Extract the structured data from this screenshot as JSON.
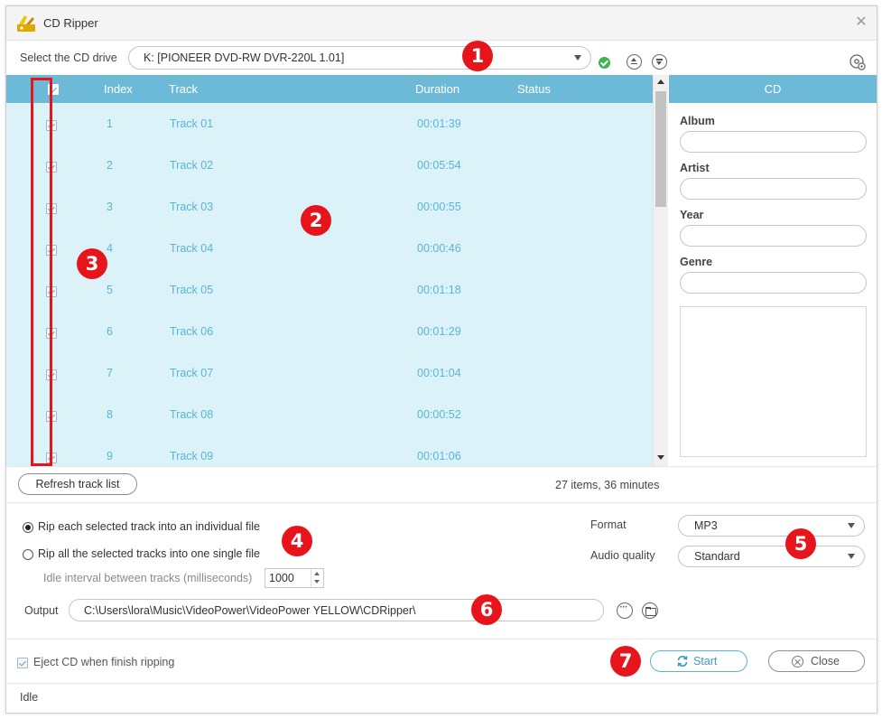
{
  "window": {
    "title": "CD Ripper"
  },
  "drive": {
    "label": "Select the CD drive",
    "selected": "K: [PIONEER DVD-RW  DVR-220L 1.01]",
    "status_color": "#3cb54a"
  },
  "table": {
    "columns": {
      "index": "Index",
      "track": "Track",
      "duration": "Duration",
      "status": "Status"
    },
    "rows": [
      {
        "index": "1",
        "track": "Track 01",
        "duration": "00:01:39",
        "status": ""
      },
      {
        "index": "2",
        "track": "Track 02",
        "duration": "00:05:54",
        "status": ""
      },
      {
        "index": "3",
        "track": "Track 03",
        "duration": "00:00:55",
        "status": ""
      },
      {
        "index": "4",
        "track": "Track 04",
        "duration": "00:00:46",
        "status": ""
      },
      {
        "index": "5",
        "track": "Track 05",
        "duration": "00:01:18",
        "status": ""
      },
      {
        "index": "6",
        "track": "Track 06",
        "duration": "00:01:29",
        "status": ""
      },
      {
        "index": "7",
        "track": "Track 07",
        "duration": "00:01:04",
        "status": ""
      },
      {
        "index": "8",
        "track": "Track 08",
        "duration": "00:00:52",
        "status": ""
      },
      {
        "index": "9",
        "track": "Track 09",
        "duration": "00:01:06",
        "status": ""
      }
    ]
  },
  "cd_panel": {
    "title": "CD",
    "album_label": "Album",
    "album": "",
    "artist_label": "Artist",
    "artist": "",
    "year_label": "Year",
    "year": "",
    "genre_label": "Genre",
    "genre": ""
  },
  "refresh": {
    "button": "Refresh track list",
    "summary": "27 items, 36 minutes"
  },
  "options": {
    "rip_individual": "Rip each selected track into an individual file",
    "rip_single": "Rip all the selected tracks into one single file",
    "idle_label": "Idle interval between tracks (milliseconds)",
    "idle_value": "1000",
    "format_label": "Format",
    "format_value": "MP3",
    "quality_label": "Audio quality",
    "quality_value": "Standard",
    "output_label": "Output",
    "output_path": "C:\\Users\\lora\\Music\\VideoPower\\VideoPower YELLOW\\CDRipper\\"
  },
  "footer": {
    "eject_label": "Eject CD when finish ripping",
    "start": "Start",
    "close": "Close",
    "status": "Idle"
  },
  "annotations": [
    "1",
    "2",
    "3",
    "4",
    "5",
    "6",
    "7"
  ],
  "colors": {
    "header": "#6cbad7",
    "table_bg": "#dbf2f8",
    "cell_text": "#5bb4d7",
    "badge": "#e8141c"
  }
}
